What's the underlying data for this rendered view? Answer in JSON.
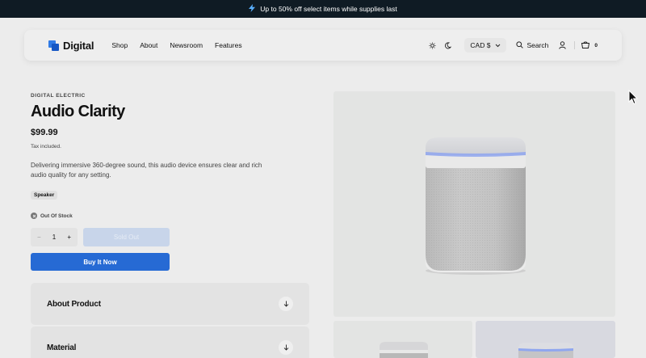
{
  "announcement": {
    "text": "Up to 50% off select items while supplies last",
    "icon": "bolt-icon"
  },
  "header": {
    "logo": "Digital",
    "nav": [
      "Shop",
      "About",
      "Newsroom",
      "Features"
    ],
    "currency": "CAD $",
    "search_label": "Search",
    "cart_count": "0"
  },
  "product": {
    "brand": "DIGITAL ELECTRIC",
    "title": "Audio Clarity",
    "price": "$99.99",
    "tax_note": "Tax included.",
    "description": "Delivering immersive 360-degree sound, this audio device ensures clear and rich audio quality for any setting.",
    "tag": "Speaker",
    "stock_status": "Out Of Stock",
    "quantity": "1",
    "minus": "−",
    "plus": "+",
    "sold_out_label": "Sold Out",
    "buy_label": "Buy It Now"
  },
  "accordion": [
    {
      "label": "About Product"
    },
    {
      "label": "Material"
    }
  ],
  "colors": {
    "accent": "#266ad4",
    "announce_bg": "#0f1b24",
    "sold_out_bg": "#c8d5ea",
    "speaker_top_glow": "#8fa6ef"
  }
}
